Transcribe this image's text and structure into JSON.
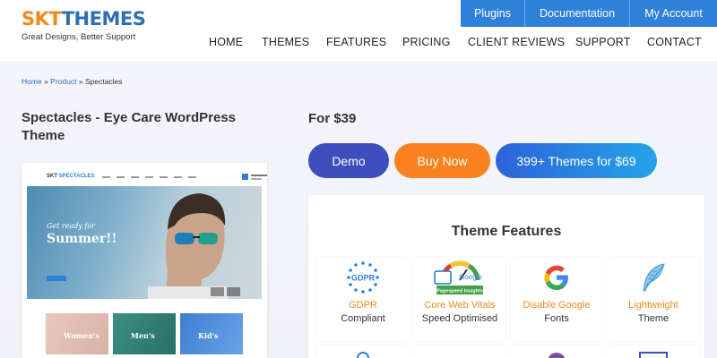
{
  "brand": {
    "logo_skt": "SKT",
    "logo_themes": "THEMES",
    "tagline": "Great Designs, Better Support",
    "colors": {
      "orange": "#f08a1b",
      "blue": "#2d6eb5",
      "topbar": "#2f80db"
    }
  },
  "topbar": {
    "plugins": "Plugins",
    "documentation": "Documentation",
    "account": "My Account"
  },
  "nav": [
    "HOME",
    "THEMES",
    "FEATURES",
    "PRICING",
    "CLIENT REVIEWS",
    "SUPPORT",
    "CONTACT"
  ],
  "breadcrumb": {
    "home": "Home",
    "sep": "»",
    "product": "Product",
    "current": "Spectacles"
  },
  "product": {
    "title": "Spectacles - Eye Care WordPress Theme",
    "price": "For $39"
  },
  "buttons": {
    "demo": "Demo",
    "buy": "Buy Now",
    "bundle": "399+ Themes for $69"
  },
  "preview": {
    "logo_skt": "SKT",
    "logo_name": "SPECTACLES",
    "hero_small": "Get ready for",
    "hero_big": "Summer!!",
    "thumbs": [
      "Women's",
      "Men's",
      "Kid's"
    ]
  },
  "features": {
    "title": "Theme Features",
    "items": [
      {
        "icon": "gdpr-icon",
        "line1": "GDPR",
        "line2": "Compliant",
        "badge": "GDPR"
      },
      {
        "icon": "pagespeed-icon",
        "line1": "Core Web Vitals",
        "line2": "Speed Optimised",
        "badge": "Google",
        "badge2": "Pagespeed Insights"
      },
      {
        "icon": "google-icon",
        "line1": "Disable Google",
        "line2": "Fonts"
      },
      {
        "icon": "feather-icon",
        "line1": "Lightweight",
        "line2": "Theme"
      }
    ]
  }
}
